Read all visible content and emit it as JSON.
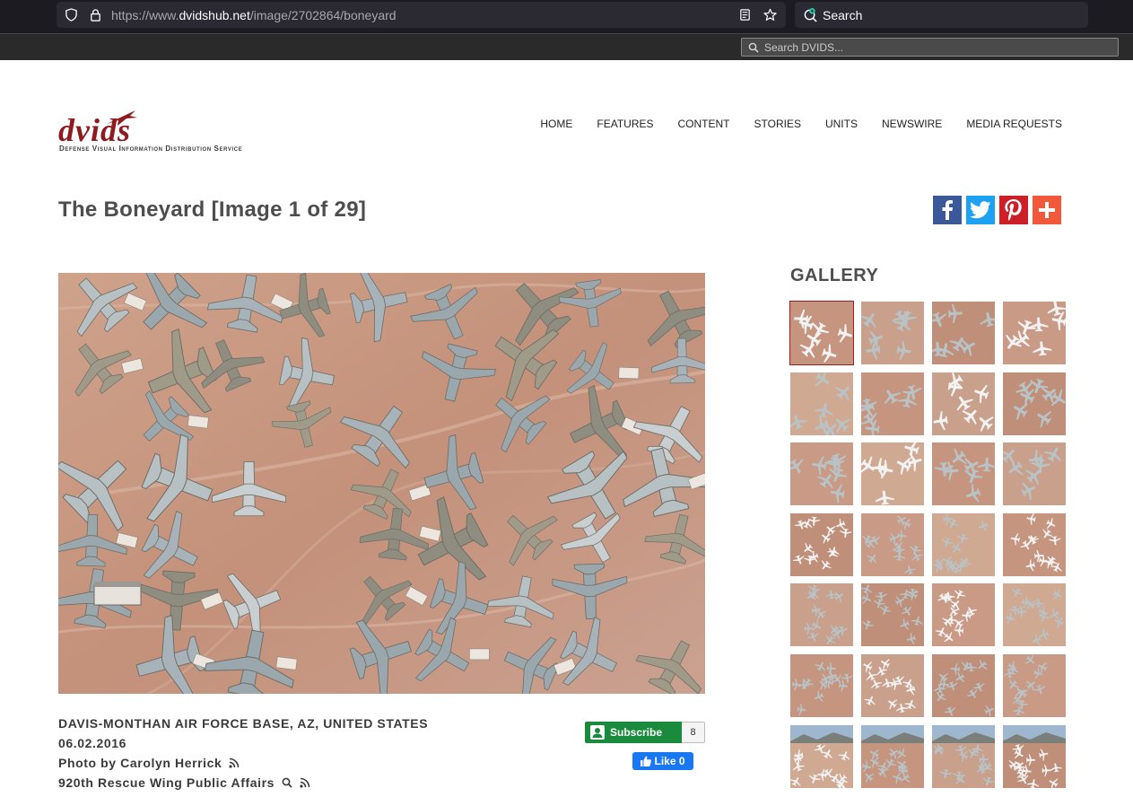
{
  "browser": {
    "url_prefix": "https://www.",
    "url_host": "dvidshub.net",
    "url_path": "/image/2702864/boneyard",
    "search_label": "Search"
  },
  "site_bar": {
    "search_placeholder": "Search DVIDS..."
  },
  "logo": {
    "word": "dvids",
    "tagline": "Defense Visual Information Distribution Service"
  },
  "nav": {
    "items": [
      "HOME",
      "FEATURES",
      "CONTENT",
      "STORIES",
      "UNITS",
      "NEWSWIRE",
      "MEDIA REQUESTS"
    ]
  },
  "page": {
    "title": "The Boneyard [Image 1 of 29]"
  },
  "share": {
    "icons": [
      "facebook-icon",
      "twitter-icon",
      "pinterest-icon",
      "plus-icon"
    ],
    "colors": [
      "#3b5998",
      "#1da1f2",
      "#cb2027",
      "#f1593a"
    ]
  },
  "meta": {
    "location": "DAVIS-MONTHAN AIR FORCE BASE, AZ, UNITED STATES",
    "date": "06.02.2016",
    "photo_by": "Photo by Carolyn Herrick",
    "unit": "920th Rescue Wing Public Affairs"
  },
  "subscribe": {
    "label": "Subscribe",
    "count": "8"
  },
  "like": {
    "label": "Like 0"
  },
  "gallery": {
    "title": "GALLERY",
    "count": 28,
    "active_index": 0
  },
  "colors": {
    "brand": "#8e1b1f",
    "sand": "#c89a83",
    "subscribe": "#1a8b3c",
    "like": "#1877f2"
  }
}
